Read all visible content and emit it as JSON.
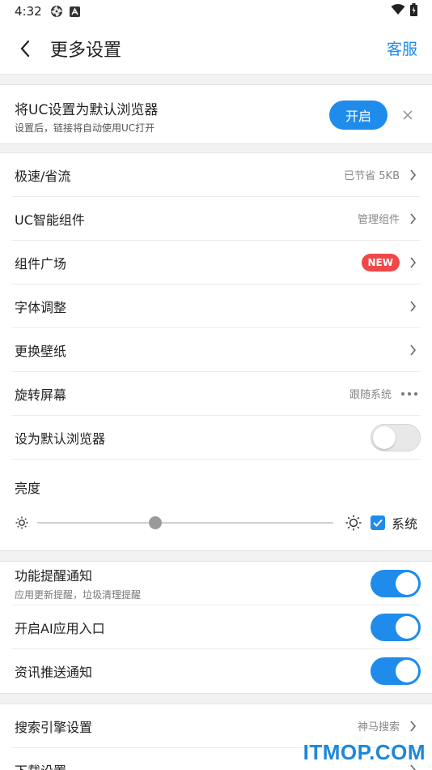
{
  "status_bar": {
    "time": "4:32"
  },
  "header": {
    "title": "更多设置",
    "service_label": "客服"
  },
  "default_browser_card": {
    "title": "将UC设置为默认浏览器",
    "subtitle": "设置后，链接将自动使用UC打开",
    "open_label": "开启"
  },
  "main_settings": {
    "speed_saving": {
      "label": "极速/省流",
      "value": "已节省 5KB"
    },
    "uc_widget": {
      "label": "UC智能组件",
      "value": "管理组件"
    },
    "widget_plaza": {
      "label": "组件广场",
      "badge": "NEW"
    },
    "font_adjust": {
      "label": "字体调整"
    },
    "wallpaper": {
      "label": "更换壁纸"
    },
    "rotate_screen": {
      "label": "旋转屏幕",
      "value": "跟随系统"
    },
    "set_default": {
      "label": "设为默认浏览器",
      "enabled": false
    },
    "brightness": {
      "label": "亮度",
      "level_fraction": 0.4,
      "system_label": "系统",
      "system_checked": true
    }
  },
  "notifications": {
    "feature_reminder": {
      "label": "功能提醒通知",
      "subtitle": "应用更新提醒，垃圾清理提醒",
      "enabled": true
    },
    "ai_entry": {
      "label": "开启AI应用入口",
      "enabled": true
    },
    "news_push": {
      "label": "资讯推送通知",
      "enabled": true
    }
  },
  "search_settings": {
    "search_engine": {
      "label": "搜索引擎设置",
      "value": "神马搜索"
    },
    "download": {
      "label": "下载设置"
    }
  },
  "watermark": "ITMOP.COM",
  "colors": {
    "accent": "#1f8ceb",
    "badge_red": "#f04848",
    "background": "#f2f2f2"
  }
}
